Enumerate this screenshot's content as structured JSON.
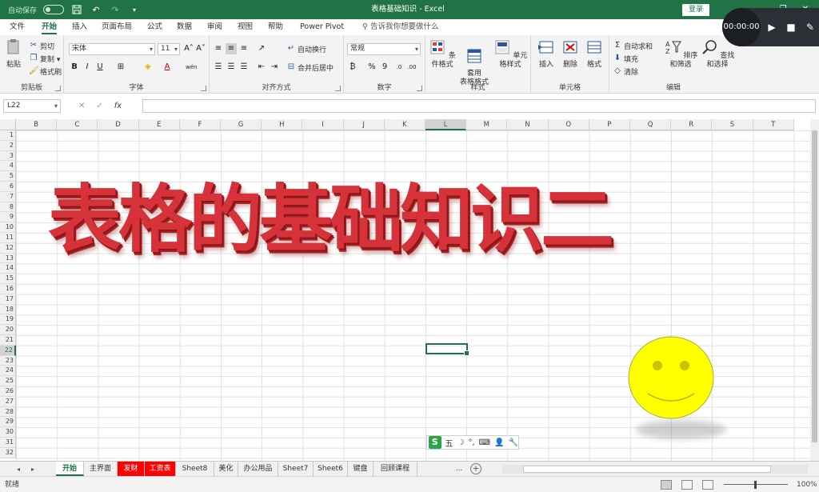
{
  "titlebar": {
    "autosave_label": "自动保存",
    "autosave_state": "关",
    "title": "表格基础知识 - Excel",
    "login": "登录",
    "minimize": "—",
    "restore": "❐",
    "close": "✕",
    "accent": "#217346"
  },
  "recorder": {
    "time": "00:00:00"
  },
  "menu": {
    "tabs": [
      {
        "label": "文件"
      },
      {
        "label": "开始"
      },
      {
        "label": "插入"
      },
      {
        "label": "页面布局"
      },
      {
        "label": "公式"
      },
      {
        "label": "数据"
      },
      {
        "label": "审阅"
      },
      {
        "label": "视图"
      },
      {
        "label": "帮助"
      },
      {
        "label": "Power Pivot"
      }
    ],
    "tellme": "告诉我你想要做什么"
  },
  "ribbon": {
    "clipboard": {
      "paste": "粘贴",
      "cut": "剪切",
      "copy": "复制 ▾",
      "painter": "格式刷",
      "label": "剪贴板"
    },
    "font": {
      "name": "宋体",
      "size": "11",
      "grow": "A˄",
      "shrink": "A˅",
      "bold": "B",
      "italic": "I",
      "underline": "U",
      "phonetic": "wén",
      "label": "字体"
    },
    "align": {
      "wrap": "自动换行",
      "merge": "合并后居中",
      "label": "对齐方式"
    },
    "number": {
      "format": "常规",
      "percent": "%",
      "comma": "9",
      "label": "数字"
    },
    "styles": {
      "cond": "条件格式",
      "table": "套用\n表格格式",
      "cell": "单元格样式",
      "label": "样式"
    },
    "cells": {
      "insert": "插入",
      "delete": "删除",
      "format": "格式",
      "label": "单元格"
    },
    "editing": {
      "autosum": "自动求和",
      "fill": "填充",
      "clear": "清除",
      "sort": "排序和筛选",
      "find": "查找和选择",
      "label": "编辑"
    }
  },
  "formula_bar": {
    "namebox": "L22",
    "content": ""
  },
  "sheet": {
    "columns": [
      "B",
      "C",
      "D",
      "E",
      "F",
      "G",
      "H",
      "I",
      "J",
      "K",
      "L",
      "M",
      "N",
      "O",
      "P",
      "Q",
      "R",
      "S",
      "T"
    ],
    "rows": [
      "1",
      "2",
      "3",
      "4",
      "5",
      "6",
      "7",
      "8",
      "9",
      "10",
      "11",
      "12",
      "13",
      "14",
      "15",
      "16",
      "17",
      "18",
      "19",
      "20",
      "21",
      "22",
      "23",
      "24",
      "25",
      "26",
      "27",
      "28",
      "29",
      "30",
      "31",
      "32"
    ],
    "selected_column": "L",
    "selected_row": "22",
    "wordart": "表格的基础知识二"
  },
  "ime": {
    "logo": "S",
    "mode": "五",
    "moon": "☽",
    "punct": "°,",
    "keyboard": "⌨",
    "user": "👤",
    "tool": "🔧"
  },
  "tabs": {
    "sheets": [
      {
        "label": "开始",
        "style": "active"
      },
      {
        "label": "主界面",
        "style": "normal"
      },
      {
        "label": "发财",
        "style": "red"
      },
      {
        "label": "工资表",
        "style": "red"
      },
      {
        "label": "Sheet8",
        "style": "normal"
      },
      {
        "label": "美化",
        "style": "normal"
      },
      {
        "label": "办公用品",
        "style": "normal"
      },
      {
        "label": "Sheet7",
        "style": "normal"
      },
      {
        "label": "Sheet6",
        "style": "normal"
      },
      {
        "label": "键盘",
        "style": "normal"
      },
      {
        "label": "回顾课程",
        "style": "normal"
      }
    ],
    "more": "...",
    "add": "+"
  },
  "status": {
    "text": "就绪",
    "zoom": "100%"
  }
}
